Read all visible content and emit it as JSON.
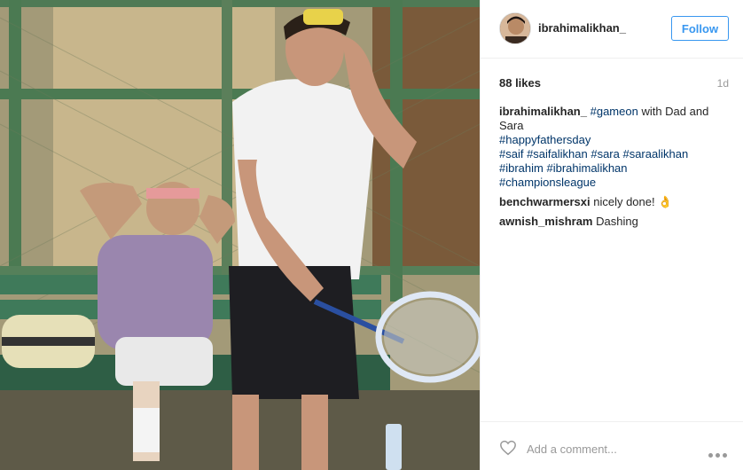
{
  "post": {
    "username": "ibrahimalikhan_",
    "follow_label": "Follow",
    "likes": "88 likes",
    "timestamp": "1d"
  },
  "caption": {
    "user": "ibrahimalikhan_",
    "tag1": "#gameon",
    "text1": " with Dad and",
    "line2": "Sara",
    "line3": "#happyfathersday",
    "line4": "#saif #saifalikhan #sara #saraalikhan",
    "line5": "#ibrahim #ibrahimalikhan",
    "line6": "#championsleague"
  },
  "comments": [
    {
      "user": "benchwarmersxi",
      "text": " nicely done! ",
      "emoji": "👌"
    },
    {
      "user": "awnish_mishram",
      "text": " Dashing"
    }
  ],
  "footer": {
    "comment_placeholder": "Add a comment...",
    "heart_icon": "heart-outline-icon",
    "more_icon": "ellipsis-icon"
  },
  "colors": {
    "accent": "#3897f0",
    "hashtag": "#003569",
    "muted": "#999999",
    "text": "#262626"
  }
}
